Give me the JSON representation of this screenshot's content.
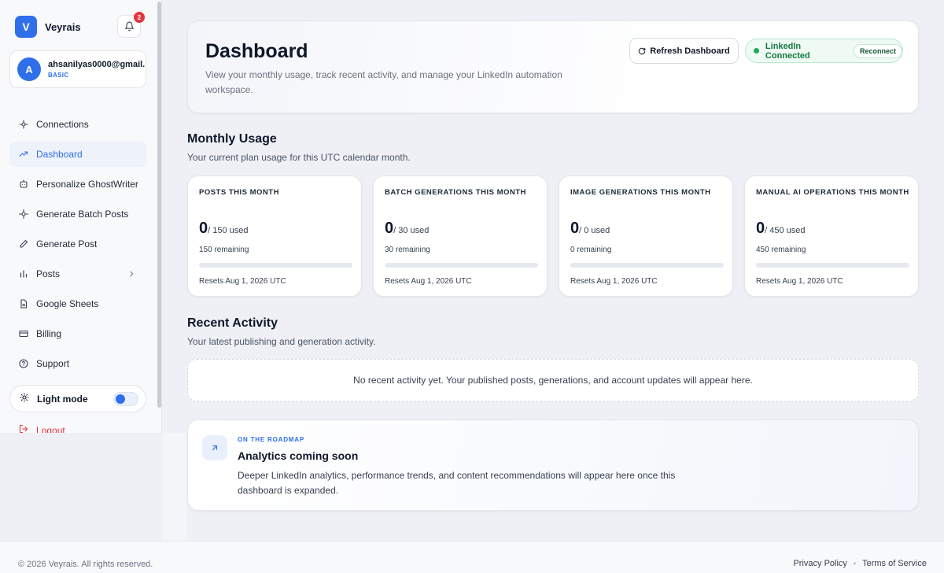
{
  "brand": {
    "logo_letter": "V",
    "name": "Veyrais"
  },
  "notifications": {
    "count": "2"
  },
  "account": {
    "initial": "A",
    "email": "ahsanilyas0000@gmail...",
    "plan": "BASIC"
  },
  "sidebar": {
    "items": [
      {
        "label": "Connections",
        "icon": "connections-icon",
        "active": false
      },
      {
        "label": "Dashboard",
        "icon": "trending-up-icon",
        "active": true
      },
      {
        "label": "Personalize GhostWriter",
        "icon": "ghostwriter-icon",
        "active": false
      },
      {
        "label": "Generate Batch Posts",
        "icon": "sparkle-icon",
        "active": false
      },
      {
        "label": "Generate Post",
        "icon": "pen-icon",
        "active": false
      },
      {
        "label": "Posts",
        "icon": "bar-chart-icon",
        "active": false,
        "has_submenu": true
      },
      {
        "label": "Google Sheets",
        "icon": "document-icon",
        "active": false
      },
      {
        "label": "Billing",
        "icon": "credit-card-icon",
        "active": false
      },
      {
        "label": "Support",
        "icon": "help-icon",
        "active": false
      }
    ],
    "theme_label": "Light mode",
    "logout_label": "Logout"
  },
  "hero": {
    "title": "Dashboard",
    "description": "View your monthly usage, track recent activity, and manage your LinkedIn automation workspace.",
    "refresh_label": "Refresh Dashboard",
    "linkedin_status": "LinkedIn Connected",
    "reconnect_label": "Reconnect"
  },
  "monthly_usage": {
    "title": "Monthly Usage",
    "subtitle": "Your current plan usage for this UTC calendar month.",
    "cards": [
      {
        "label": "POSTS THIS MONTH",
        "used": "0",
        "limit": "/ 150 used",
        "remaining": "150 remaining",
        "progress": 0,
        "resets": "Resets Aug 1, 2026 UTC"
      },
      {
        "label": "BATCH GENERATIONS THIS MONTH",
        "used": "0",
        "limit": "/ 30 used",
        "remaining": "30 remaining",
        "progress": 0,
        "resets": "Resets Aug 1, 2026 UTC"
      },
      {
        "label": "IMAGE GENERATIONS THIS MONTH",
        "used": "0",
        "limit": "/ 0 used",
        "remaining": "0 remaining",
        "progress": 0,
        "resets": "Resets Aug 1, 2026 UTC"
      },
      {
        "label": "MANUAL AI OPERATIONS THIS MONTH",
        "used": "0",
        "limit": "/ 450 used",
        "remaining": "450 remaining",
        "progress": 0,
        "resets": "Resets Aug 1, 2026 UTC"
      }
    ]
  },
  "recent_activity": {
    "title": "Recent Activity",
    "subtitle": "Your latest publishing and generation activity.",
    "empty_message": "No recent activity yet. Your published posts, generations, and account updates will appear here."
  },
  "roadmap": {
    "kicker": "ON THE ROADMAP",
    "title": "Analytics coming soon",
    "description": "Deeper LinkedIn analytics, performance trends, and content recommendations will appear here once this dashboard is expanded."
  },
  "footer": {
    "copyright": "© 2026 Veyrais. All rights reserved.",
    "privacy_label": "Privacy Policy",
    "terms_label": "Terms of Service"
  },
  "colors": {
    "accent": "#2f6fea",
    "success": "#1faa5a",
    "danger": "#e5353b"
  }
}
